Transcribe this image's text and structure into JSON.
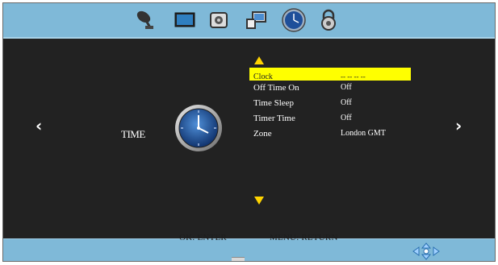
{
  "tabs": [
    {
      "name": "satellite-icon"
    },
    {
      "name": "picture-icon"
    },
    {
      "name": "sound-icon"
    },
    {
      "name": "screen-icon"
    },
    {
      "name": "time-icon",
      "selected": true
    },
    {
      "name": "lock-icon"
    }
  ],
  "section": {
    "title": "TIME"
  },
  "menu": {
    "items": [
      {
        "label": "Clock",
        "value": "-- --   -- --",
        "selected": true
      },
      {
        "label": "Off Time On",
        "value": "Off"
      },
      {
        "label": "Time Sleep",
        "value": "Off"
      },
      {
        "label": "Timer Time",
        "value": "Off"
      },
      {
        "label": "Zone",
        "value": "London  GMT"
      }
    ]
  },
  "hints": {
    "enter": "OK: ENTER",
    "menu": "MENU: RETURN"
  },
  "colors": {
    "bar": "#7fb9d8",
    "panel": "#222222",
    "highlight": "#ffff00",
    "arrow": "#ffd400"
  }
}
